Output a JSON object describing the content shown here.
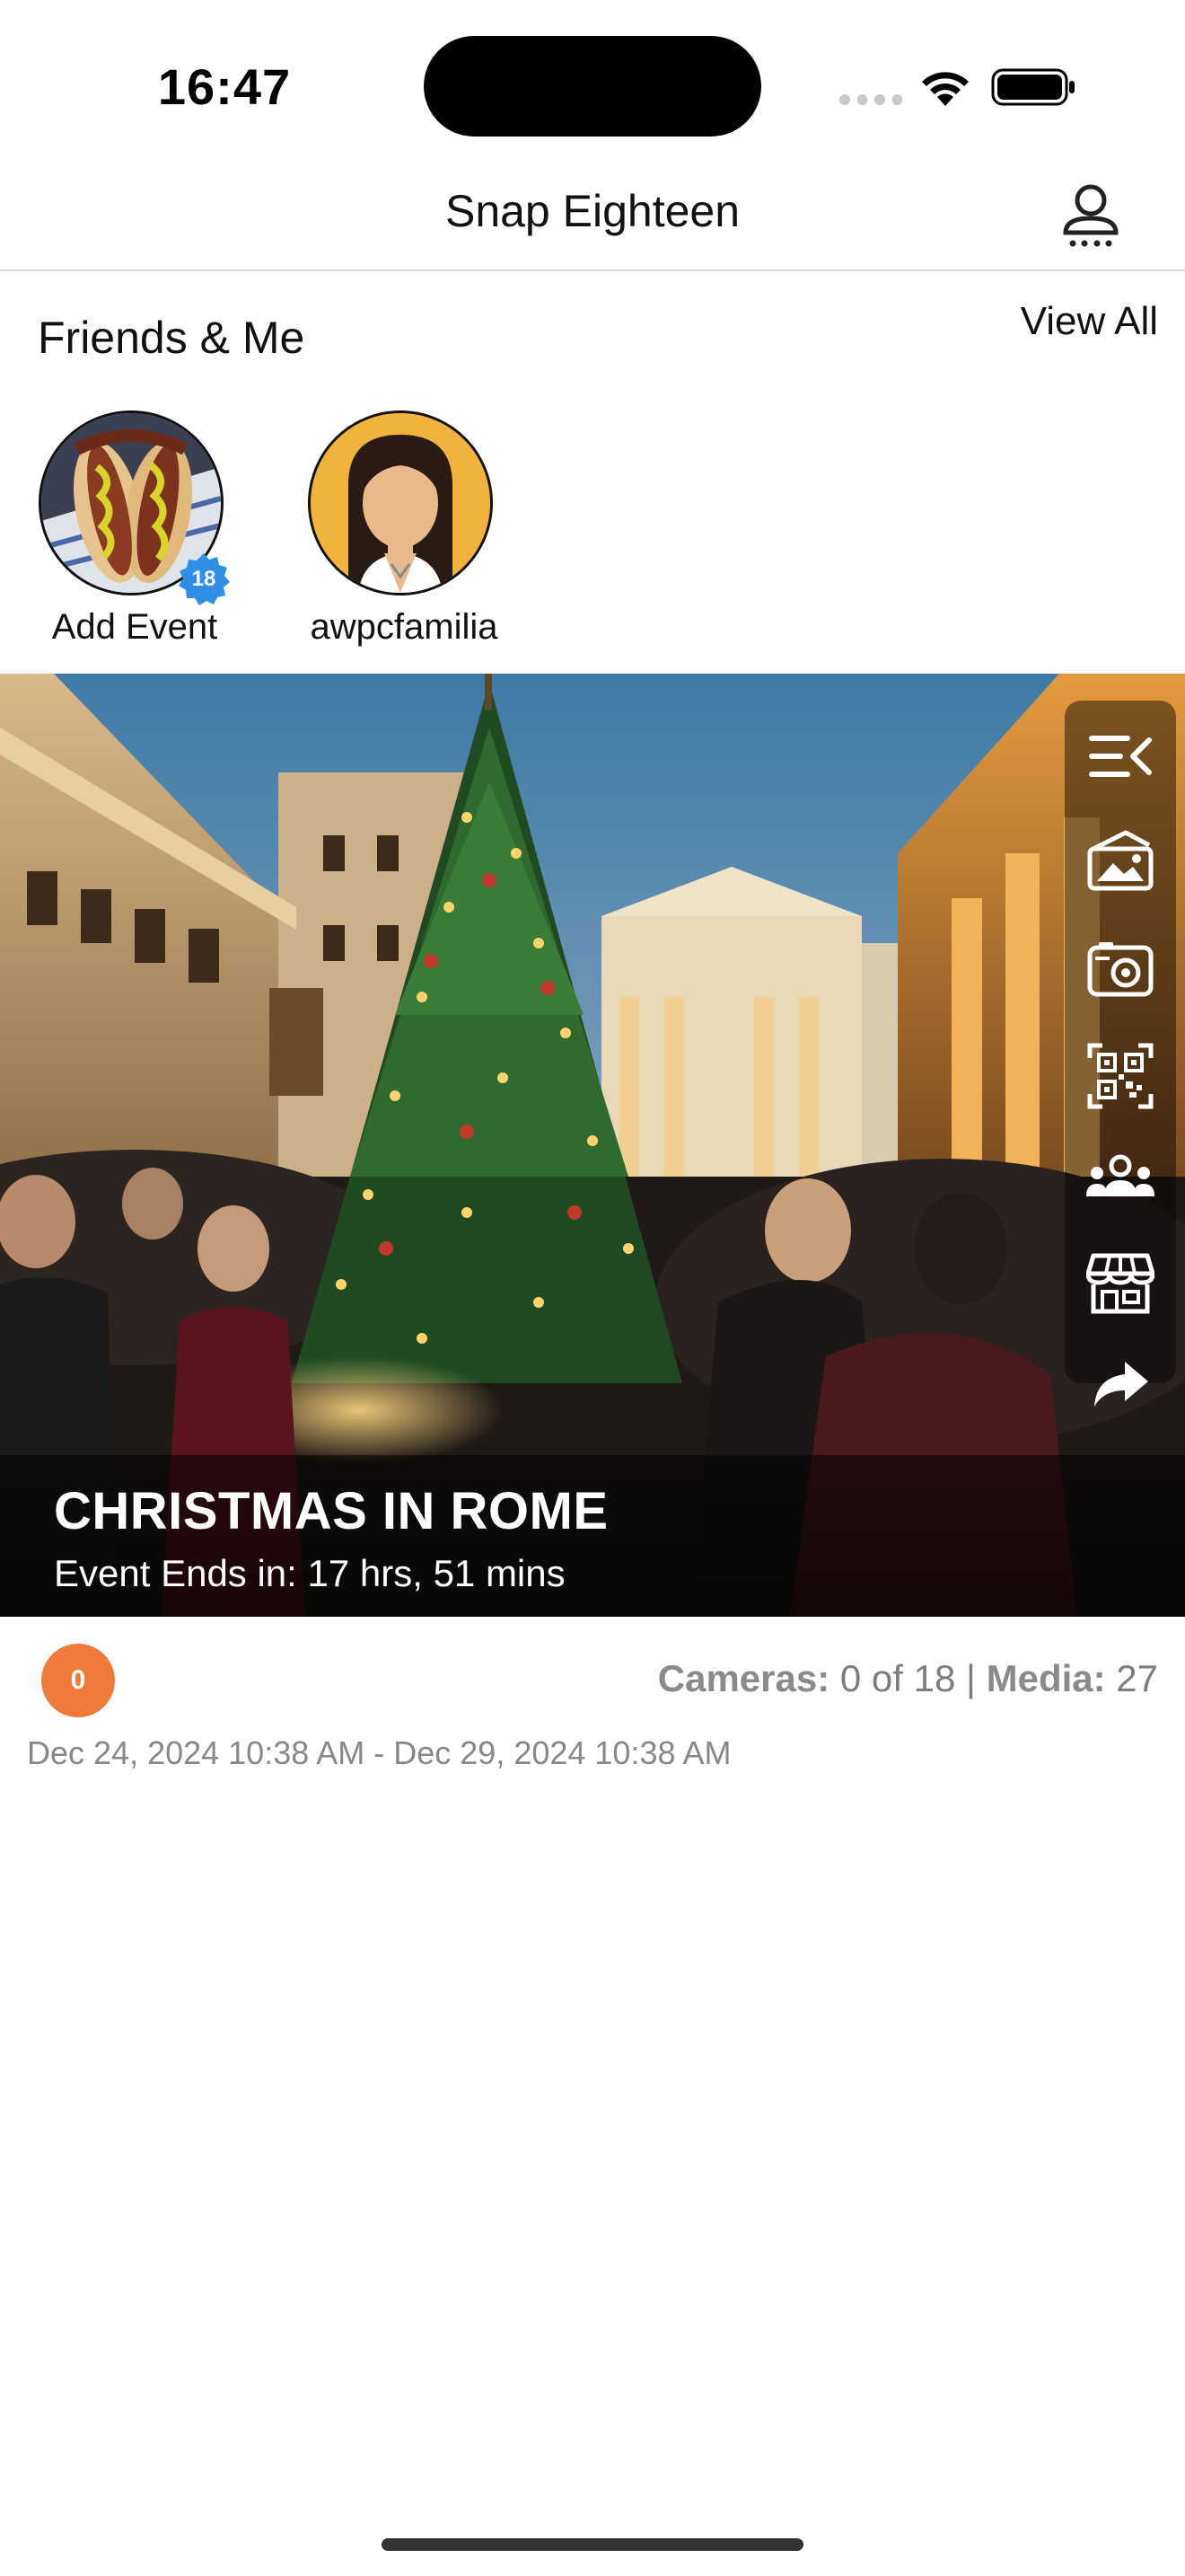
{
  "status_bar": {
    "time": "16:47"
  },
  "header": {
    "title": "Snap Eighteen"
  },
  "friends": {
    "title": "Friends & Me",
    "view_all": "View All",
    "items": [
      {
        "label": "Add Event",
        "badge": "18"
      },
      {
        "label": "awpcfamilia"
      }
    ]
  },
  "event": {
    "title": "CHRISTMAS IN ROME",
    "countdown": "Event Ends in: 17 hrs, 51 mins",
    "count_badge": "0",
    "cameras_label": "Cameras:",
    "cameras_value": "0 of 18",
    "separator": "|",
    "media_label": "Media:",
    "media_value": "27",
    "date_range": "Dec 24, 2024 10:38 AM - Dec 29, 2024 10:38 AM"
  },
  "toolbar": {
    "icons": [
      "collapse-menu-icon",
      "gallery-icon",
      "camera-icon",
      "qr-code-icon",
      "people-icon",
      "store-icon",
      "share-icon"
    ]
  },
  "colors": {
    "accent_orange": "#ef7a3a",
    "badge_blue": "#2f8fe6",
    "avatar_bg": "#f2b33d"
  }
}
